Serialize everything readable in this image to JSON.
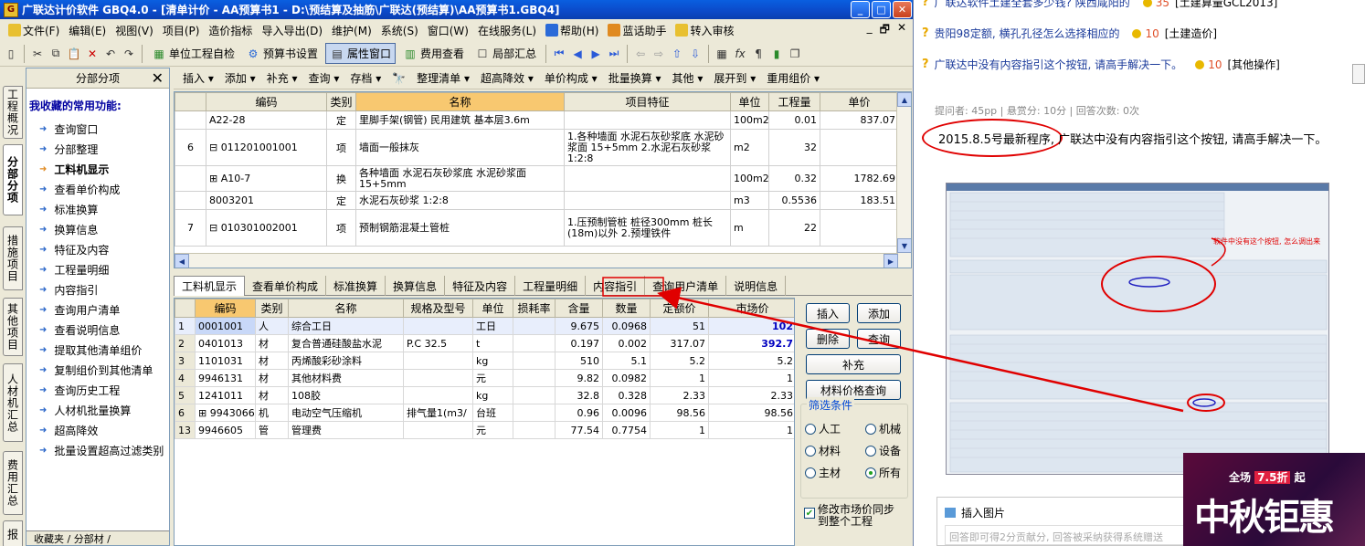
{
  "window": {
    "title": "广联达计价软件 GBQ4.0 - [清单计价 - AA预算书1 - D:\\预结算及抽筋\\广联达(预结算)\\AA预算书1.GBQ4]"
  },
  "menu": {
    "items": [
      "文件(F)",
      "编辑(E)",
      "视图(V)",
      "项目(P)",
      "造价指标",
      "导入导出(D)",
      "维护(M)",
      "系统(S)",
      "窗口(W)",
      "在线服务(L)",
      "帮助(H)",
      "蓝话助手",
      "转入审核"
    ],
    "right": [
      "_",
      "🗗",
      "✕"
    ]
  },
  "toolbar1": {
    "unit_check": "单位工程自检",
    "budget_settings": "预算书设置",
    "property_window": "属性窗口",
    "fee_view": "费用查看",
    "local_summary": "局部汇总"
  },
  "vtabs": [
    "工程概况",
    "分部分项",
    "措施项目",
    "其他项目",
    "人材机汇总",
    "费用汇总",
    "报"
  ],
  "sidepanel": {
    "header": "分部分项",
    "subtitle": "我收藏的常用功能:",
    "items": [
      "查询窗口",
      "分部整理",
      "工料机显示",
      "查看单价构成",
      "标准换算",
      "换算信息",
      "特征及内容",
      "工程量明细",
      "内容指引",
      "查询用户清单",
      "查看说明信息",
      "提取其他清单组价",
      "复制组价到其他清单",
      "查询历史工程",
      "人材机批量换算",
      "超高降效",
      "批量设置超高过滤类别"
    ],
    "footer": "收藏夹 / 分部材 /"
  },
  "toolbar2": [
    "插入 ▾",
    "添加 ▾",
    "补充 ▾",
    "查询 ▾",
    "存档 ▾",
    "整理清单 ▾",
    "超高降效 ▾",
    "单价构成 ▾",
    "批量换算 ▾",
    "其他 ▾",
    "展开到 ▾",
    "重用组价 ▾"
  ],
  "upper": {
    "headers": [
      "",
      "编码",
      "类别",
      "名称",
      "项目特征",
      "单位",
      "工程量",
      "单价"
    ],
    "rows": [
      {
        "no": "",
        "code": "A22-28",
        "type": "定",
        "name": "里脚手架(钢管) 民用建筑 基本层3.6m",
        "feature": "",
        "unit": "100m2",
        "qty": "0.01",
        "price": "837.07"
      },
      {
        "no": "6",
        "code": "011201001001",
        "type": "项",
        "name": "墙面一般抹灰",
        "feature": "1.各种墙面 水泥石灰砂浆底 水泥砂浆面 15+5mm 2.水泥石灰砂浆 1:2:8",
        "unit": "m2",
        "qty": "32",
        "price": ""
      },
      {
        "no": "",
        "code": "A10-7",
        "type": "换",
        "name": "各种墙面 水泥石灰砂浆底 水泥砂浆面 15+5mm",
        "feature": "",
        "unit": "100m2",
        "qty": "0.32",
        "price": "1782.69"
      },
      {
        "no": "",
        "code": "8003201",
        "type": "定",
        "name": "水泥石灰砂浆 1:2:8",
        "feature": "",
        "unit": "m3",
        "qty": "0.5536",
        "price": "183.51"
      },
      {
        "no": "7",
        "code": "010301002001",
        "type": "项",
        "name": "预制钢筋混凝土管桩",
        "feature": "1.压预制管桩 桩径300mm 桩长(18m)以外 2.预埋铁件",
        "unit": "m",
        "qty": "22",
        "price": ""
      }
    ]
  },
  "lowtabs": [
    "工料机显示",
    "查看单价构成",
    "标准换算",
    "换算信息",
    "特征及内容",
    "工程量明细",
    "内容指引",
    "查询用户清单",
    "说明信息"
  ],
  "lower": {
    "headers": [
      "",
      "编码",
      "类别",
      "名称",
      "规格及型号",
      "单位",
      "损耗率",
      "含量",
      "数量",
      "定额价",
      "市场价"
    ],
    "rows": [
      {
        "rn": "1",
        "code": "0001001",
        "type": "人",
        "name": "综合工日",
        "spec": "",
        "unit": "工日",
        "loss": "",
        "content": "9.675",
        "qty": "0.0968",
        "quota": "51",
        "market": "102"
      },
      {
        "rn": "2",
        "code": "0401013",
        "type": "材",
        "name": "复合普通硅酸盐水泥",
        "spec": "P.C 32.5",
        "unit": "t",
        "loss": "",
        "content": "0.197",
        "qty": "0.002",
        "quota": "317.07",
        "market": "392.7"
      },
      {
        "rn": "3",
        "code": "1101031",
        "type": "材",
        "name": "丙烯酸彩砂涂料",
        "spec": "",
        "unit": "kg",
        "loss": "",
        "content": "510",
        "qty": "5.1",
        "quota": "5.2",
        "market": "5.2"
      },
      {
        "rn": "4",
        "code": "9946131",
        "type": "材",
        "name": "其他材料费",
        "spec": "",
        "unit": "元",
        "loss": "",
        "content": "9.82",
        "qty": "0.0982",
        "quota": "1",
        "market": "1"
      },
      {
        "rn": "5",
        "code": "1241011",
        "type": "材",
        "name": "108胶",
        "spec": "",
        "unit": "kg",
        "loss": "",
        "content": "32.8",
        "qty": "0.328",
        "quota": "2.33",
        "market": "2.33"
      },
      {
        "rn": "6",
        "code": "9943066",
        "type": "机",
        "name": "电动空气压缩机",
        "spec": "排气量1(m3/",
        "unit": "台班",
        "loss": "",
        "content": "0.96",
        "qty": "0.0096",
        "quota": "98.56",
        "market": "98.56"
      },
      {
        "rn": "13",
        "code": "9946605",
        "type": "管",
        "name": "管理费",
        "spec": "",
        "unit": "元",
        "loss": "",
        "content": "77.54",
        "qty": "0.7754",
        "quota": "1",
        "market": "1"
      }
    ]
  },
  "rightbtns": {
    "insert": "插入",
    "add": "添加",
    "delete": "删除",
    "query": "查询",
    "supplement": "补充",
    "material_query": "材料价格查询"
  },
  "filter": {
    "title": "筛选条件",
    "options": [
      "人工",
      "机械",
      "材料",
      "设备",
      "主材",
      "所有"
    ],
    "selected": "所有"
  },
  "sync": {
    "label": "修改市场价同步到整个工程",
    "checked": true
  },
  "web": {
    "questions": [
      {
        "title": "广联达软件土建全套多少钱? 陕西咸阳的",
        "points": "35",
        "category": "[土建算量GCL2013]"
      },
      {
        "title": "贵阳98定额, 横孔孔径怎么选择相应的",
        "points": "10",
        "category": "[土建造价]"
      },
      {
        "title": "广联达中没有内容指引这个按钮, 请高手解决一下。",
        "points": "10",
        "category": "[其他操作]"
      }
    ],
    "meta": "提问者: 45pp  |  悬赏分: 10分  |  回答次数: 0次",
    "question_text": "2015.8.5号最新程序, 广联达中没有内容指引这个按钮, 请高手解决一下。",
    "annotation": "软件中没有这个按钮, 怎么调出来",
    "upload_label": "插入图片",
    "answer_placeholder": "回答即可得2分贡献分, 回答被采纳获得系统赠送",
    "promo": {
      "line1": "全场",
      "discount": "7.5折",
      "line1b": "起",
      "big": "中秋钜惠"
    }
  }
}
